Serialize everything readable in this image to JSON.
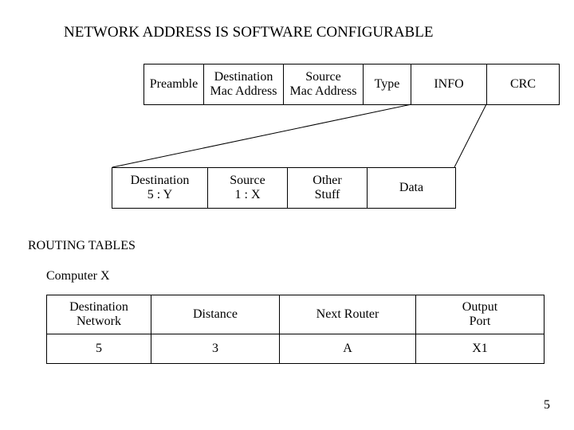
{
  "title": "NETWORK ADDRESS IS SOFTWARE CONFIGURABLE",
  "frame_top": {
    "preamble": "Preamble",
    "dest_mac_l1": "Destination",
    "dest_mac_l2": "Mac Address",
    "src_mac_l1": "Source",
    "src_mac_l2": "Mac Address",
    "type": "Type",
    "info": "INFO",
    "crc": "CRC"
  },
  "frame_mid": {
    "dest_l1": "Destination",
    "dest_l2": "5 : Y",
    "src_l1": "Source",
    "src_l2": "1 : X",
    "other_l1": "Other",
    "other_l2": "Stuff",
    "data": "Data"
  },
  "routing": {
    "section": "ROUTING TABLES",
    "computer": "Computer   X",
    "headers": {
      "dest_l1": "Destination",
      "dest_l2": "Network",
      "distance": "Distance",
      "next": "Next Router",
      "out_l1": "Output",
      "out_l2": "Port"
    },
    "row": {
      "dest": "5",
      "distance": "3",
      "next": "A",
      "out": "X1"
    }
  },
  "page": "5"
}
